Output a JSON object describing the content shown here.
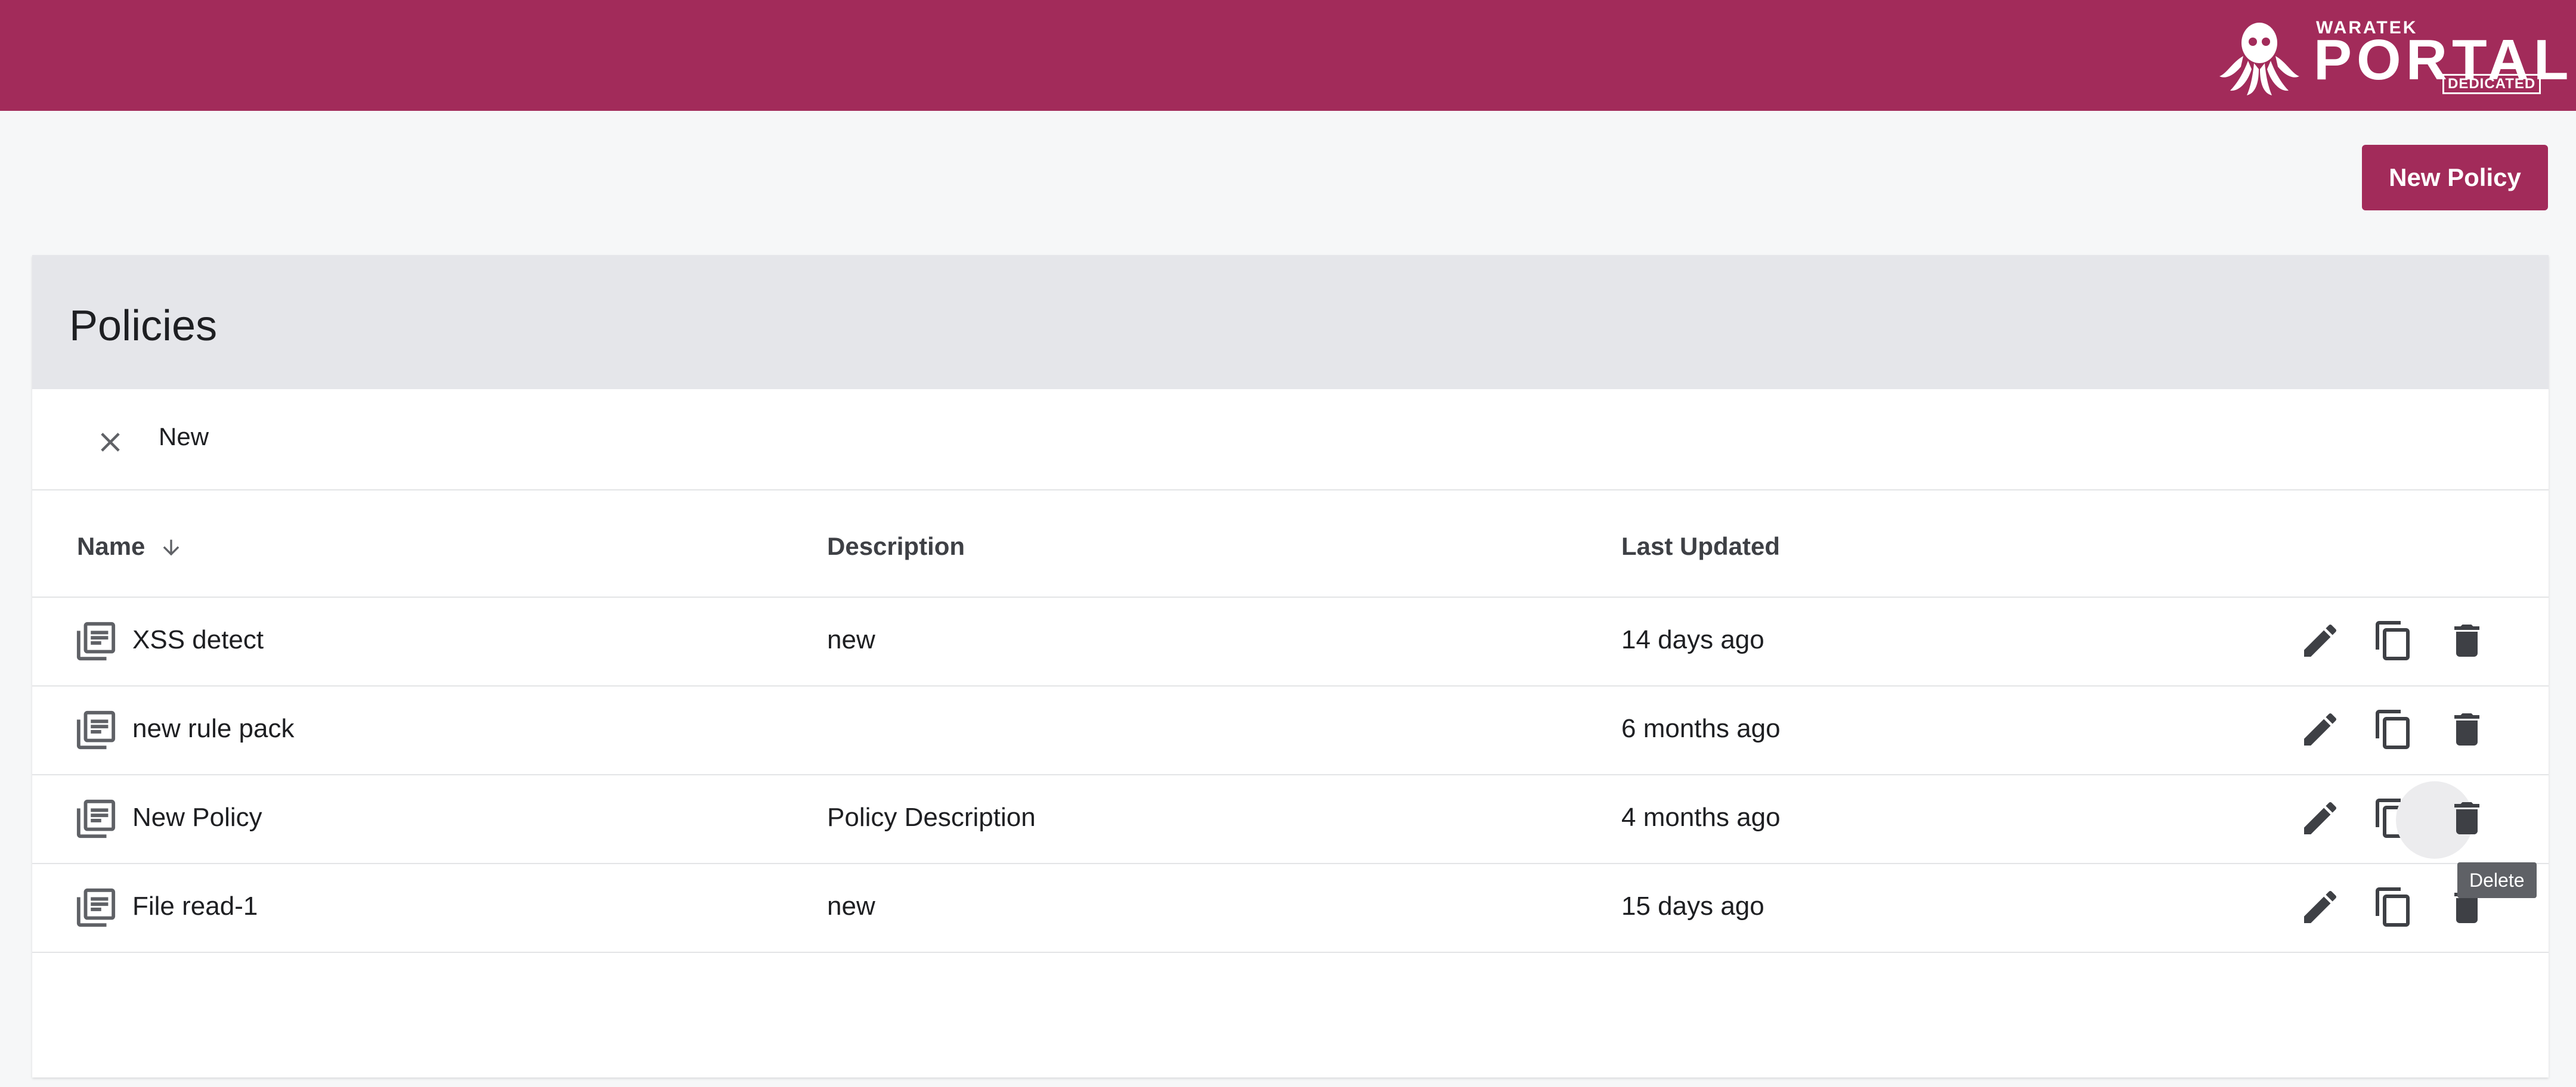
{
  "header": {
    "logo": {
      "brand": "WARATEK",
      "product": "PORTAL",
      "edition": "DEDICATED"
    },
    "colors": {
      "primary": "#a22b5a"
    }
  },
  "toolbar": {
    "new_policy_label": "New Policy"
  },
  "policies": {
    "title": "Policies",
    "filter": {
      "value": "New",
      "clear_icon": "close-icon"
    },
    "columns": {
      "name": "Name",
      "description": "Description",
      "last_updated": "Last Updated"
    },
    "sort": {
      "column": "name",
      "direction": "descending",
      "icon": "arrow-down-icon"
    },
    "rows": [
      {
        "name": "XSS detect",
        "description": "new",
        "last_updated": "14 days ago"
      },
      {
        "name": "new rule pack",
        "description": "",
        "last_updated": "6 months ago"
      },
      {
        "name": "New Policy",
        "description": "Policy Description",
        "last_updated": "4 months ago"
      },
      {
        "name": "File read-1",
        "description": "new",
        "last_updated": "15 days ago"
      }
    ],
    "row_icon": "document-list-icon",
    "actions": [
      "edit-icon",
      "copy-icon",
      "delete-icon"
    ]
  },
  "tooltip": {
    "text": "Delete"
  }
}
